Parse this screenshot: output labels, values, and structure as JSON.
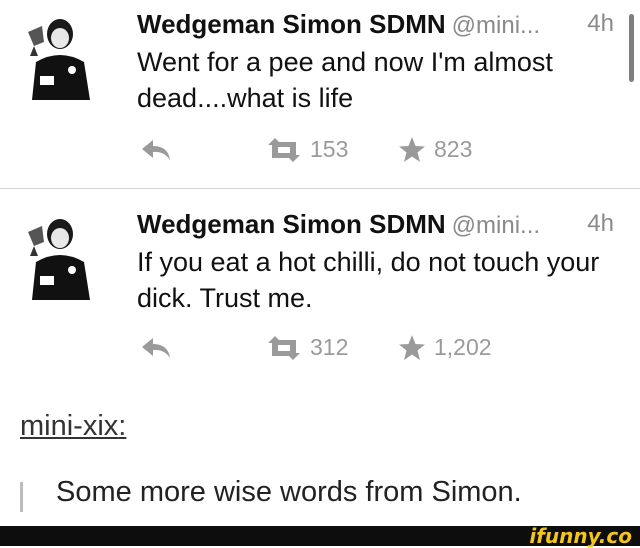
{
  "tweets": [
    {
      "author": "Wedgeman Simon SDMN",
      "handle": "@mini...",
      "time": "4h",
      "text": "Went for a pee and now I'm almost dead....what is life",
      "retweets": "153",
      "favorites": "823"
    },
    {
      "author": "Wedgeman Simon SDMN",
      "handle": "@mini...",
      "time": "4h",
      "text": "If you eat a hot chilli, do not touch your dick. Trust me.",
      "retweets": "312",
      "favorites": "1,202"
    }
  ],
  "post": {
    "poster": "mini-xix",
    "poster_suffix": ":",
    "quote": "Some more wise words from Simon."
  },
  "watermark": "ifunny.co",
  "colors": {
    "meta_gray": "#8a8a8a",
    "action_gray": "#9a9a9a",
    "footer": "#0d0d0d",
    "watermark": "#f5c518"
  }
}
